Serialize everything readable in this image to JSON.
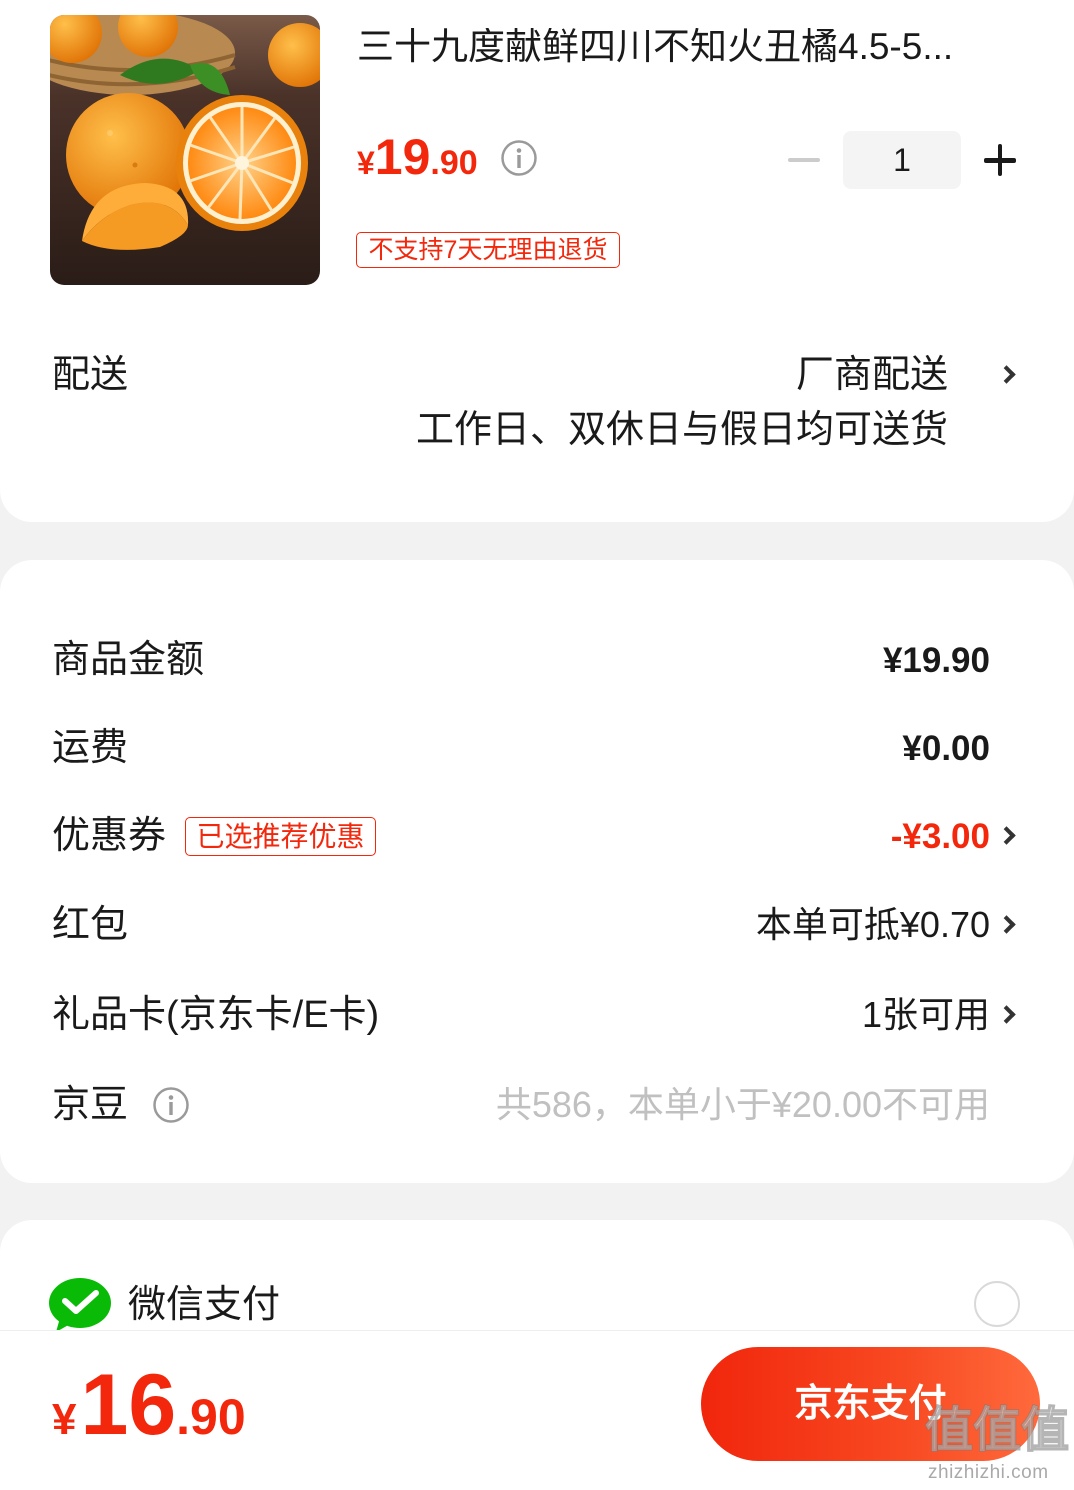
{
  "product": {
    "title": "三十九度献鲜四川不知火丑橘4.5-5...",
    "price_symbol": "¥",
    "price_int": "19",
    "price_dec": ".90",
    "quantity": "1",
    "return_badge": "不支持7天无理由退货",
    "image_icon": "orange-product-photo"
  },
  "delivery": {
    "label": "配送",
    "method": "厂商配送",
    "schedule": "工作日、双休日与假日均可送货"
  },
  "summary": {
    "rows": [
      {
        "label": "商品金额",
        "value": "¥19.90"
      },
      {
        "label": "运费",
        "value": "¥0.00"
      },
      {
        "label": "优惠券",
        "badge": "已选推荐优惠",
        "value": "-¥3.00"
      },
      {
        "label": "红包",
        "value": "本单可抵¥0.70"
      },
      {
        "label": "礼品卡(京东卡/E卡)",
        "value": "1张可用"
      },
      {
        "label": "京豆",
        "value": "共586，本单小于¥20.00不可用"
      }
    ]
  },
  "payment": {
    "method_label": "微信支付",
    "icon": "wechat-pay-icon"
  },
  "footer": {
    "price_symbol": "¥",
    "price_int": "16",
    "price_dec": ".90",
    "pay_button": "京东支付"
  },
  "watermark": {
    "logo_text": "值值值",
    "url": "zhizhizhi.com"
  },
  "colors": {
    "accent": "#f2270c",
    "wechat_green": "#09bb07",
    "muted_text": "#c0c0c0"
  }
}
